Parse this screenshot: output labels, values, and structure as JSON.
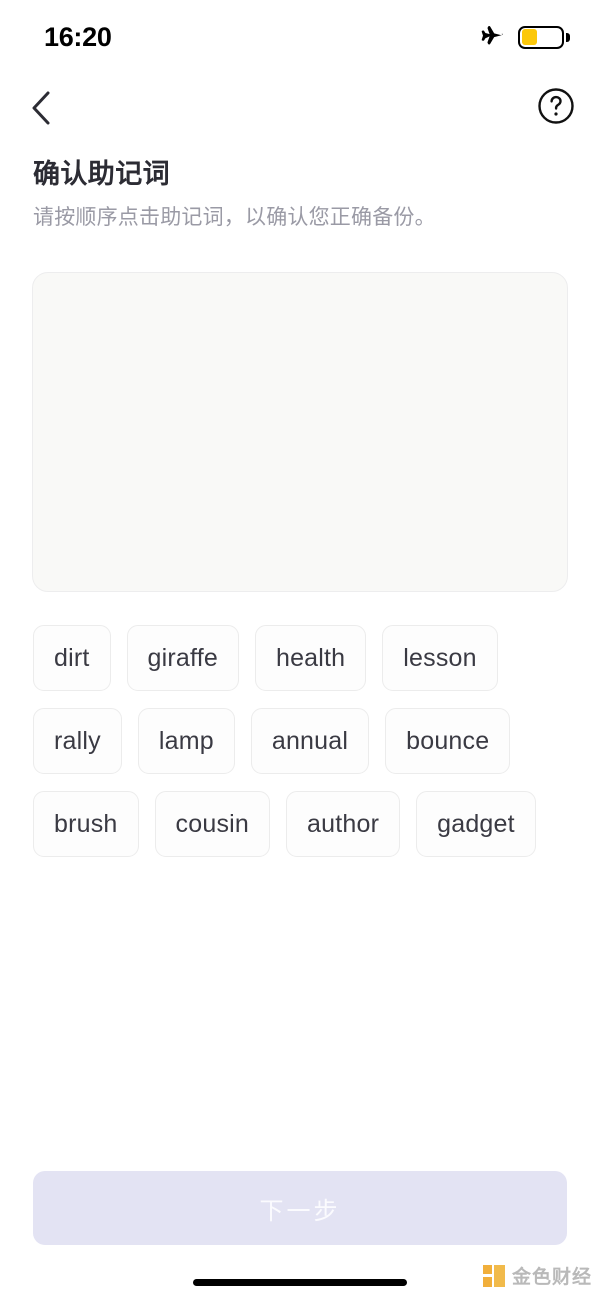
{
  "status_bar": {
    "time": "16:20",
    "airplane_icon": "airplane-mode-icon",
    "battery_icon": "battery-low-power-icon",
    "battery_level_percent": 40
  },
  "nav_bar": {
    "back_icon": "chevron-left-icon",
    "help_icon": "question-mark-circle-icon"
  },
  "heading": {
    "title": "确认助记词",
    "subtitle": "请按顺序点击助记词，以确认您正确备份。"
  },
  "drop_area": {
    "selected_words": [],
    "placeholder": ""
  },
  "word_pool": {
    "words": [
      "dirt",
      "giraffe",
      "health",
      "lesson",
      "rally",
      "lamp",
      "annual",
      "bounce",
      "brush",
      "cousin",
      "author",
      "gadget"
    ]
  },
  "primary_action": {
    "label": "下一步",
    "enabled": false
  },
  "watermark": {
    "text": "金色财经"
  },
  "colors": {
    "accent": "#e3e3f3",
    "battery_fill": "#fcc80a",
    "title": "#2c2c34",
    "subtitle": "#9a9aa5",
    "chip_text": "#3a3a43",
    "drop_area_bg": "#f9f9f7",
    "watermark": "#f0b53c"
  }
}
